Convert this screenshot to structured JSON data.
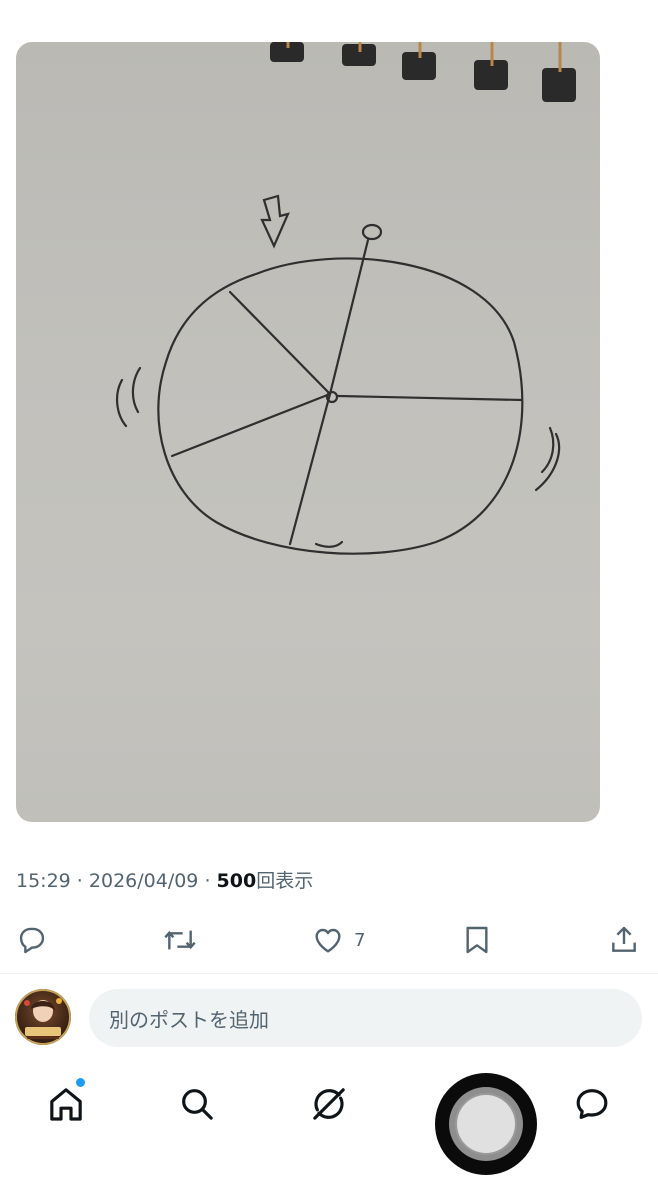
{
  "post": {
    "image_description_icon": "hand-drawn-roulette-sketch",
    "time": "15:29",
    "separator": " · ",
    "date": "2026/04/09",
    "views_count": "500",
    "views_label": "回表示"
  },
  "actions": {
    "reply_icon": "reply-icon",
    "repost_icon": "repost-icon",
    "like_icon": "heart-icon",
    "like_count": "7",
    "bookmark_icon": "bookmark-icon",
    "share_icon": "share-icon"
  },
  "composer": {
    "placeholder": "別のポストを追加"
  },
  "nav": {
    "items": [
      "home-icon",
      "search-icon",
      "grok-icon",
      "record-button",
      "messages-icon"
    ],
    "home_has_notification": true
  },
  "colors": {
    "secondary_text": "#536471",
    "primary_text": "#0f1419",
    "accent": "#1d9bf0"
  }
}
